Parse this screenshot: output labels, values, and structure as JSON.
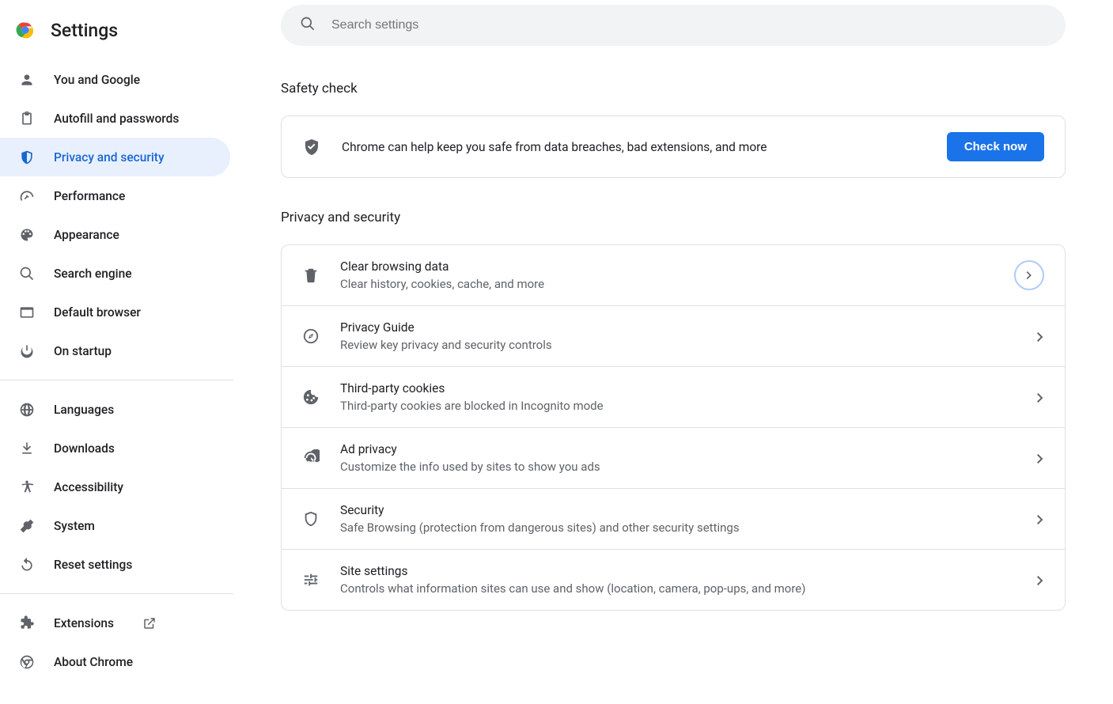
{
  "header": {
    "title": "Settings"
  },
  "search": {
    "placeholder": "Search settings"
  },
  "sidebar": {
    "items": [
      {
        "label": "You and Google"
      },
      {
        "label": "Autofill and passwords"
      },
      {
        "label": "Privacy and security"
      },
      {
        "label": "Performance"
      },
      {
        "label": "Appearance"
      },
      {
        "label": "Search engine"
      },
      {
        "label": "Default browser"
      },
      {
        "label": "On startup"
      }
    ],
    "items2": [
      {
        "label": "Languages"
      },
      {
        "label": "Downloads"
      },
      {
        "label": "Accessibility"
      },
      {
        "label": "System"
      },
      {
        "label": "Reset settings"
      }
    ],
    "items3": [
      {
        "label": "Extensions"
      },
      {
        "label": "About Chrome"
      }
    ]
  },
  "safety": {
    "section_title": "Safety check",
    "text": "Chrome can help keep you safe from data breaches, bad extensions, and more",
    "button": "Check now"
  },
  "privacy": {
    "section_title": "Privacy and security",
    "rows": [
      {
        "title": "Clear browsing data",
        "subtitle": "Clear history, cookies, cache, and more"
      },
      {
        "title": "Privacy Guide",
        "subtitle": "Review key privacy and security controls"
      },
      {
        "title": "Third-party cookies",
        "subtitle": "Third-party cookies are blocked in Incognito mode"
      },
      {
        "title": "Ad privacy",
        "subtitle": "Customize the info used by sites to show you ads"
      },
      {
        "title": "Security",
        "subtitle": "Safe Browsing (protection from dangerous sites) and other security settings"
      },
      {
        "title": "Site settings",
        "subtitle": "Controls what information sites can use and show (location, camera, pop-ups, and more)"
      }
    ]
  }
}
